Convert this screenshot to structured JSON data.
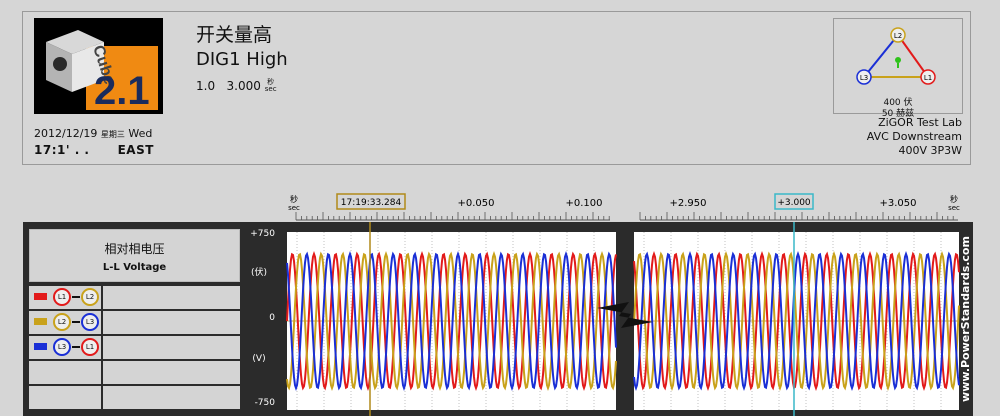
{
  "header": {
    "logo_word": "Cube",
    "logo_version": "2.1",
    "event_title_cn": "开关量高",
    "event_title_en": "DIG1 High",
    "duration_count": "1.0",
    "duration_value": "3.000",
    "duration_unit_cn": "秒",
    "duration_unit_en": "sec",
    "date": "2012/12/19",
    "weekday_cn": "星期三",
    "weekday_en": "Wed",
    "time": "17:1'  .   .",
    "timezone": "EAST"
  },
  "phasor": {
    "labels": [
      "L2",
      "L3",
      "L1"
    ],
    "voltage": "400 伏",
    "frequency": "50 赫兹"
  },
  "site": {
    "lab": "ZiGOR Test Lab",
    "location": "AVC Downstream",
    "config": "400V 3P3W"
  },
  "time_axis": {
    "unit_cn": "秒",
    "unit_en": "sec",
    "trigger_time": "17:19:33.284",
    "left_ticks": [
      "+0.050",
      "+0.100"
    ],
    "right_ticks": [
      "+2.950",
      "+3.050"
    ],
    "cursor_label": "+3.000"
  },
  "legend": {
    "title_cn": "相对相电压",
    "title_en": "L-L Voltage",
    "rows": [
      {
        "a": "L1",
        "b": "L2",
        "color": "#e21a1a"
      },
      {
        "a": "L2",
        "b": "L3",
        "color": "#c9a21b"
      },
      {
        "a": "L3",
        "b": "L1",
        "color": "#1a2fd6"
      }
    ]
  },
  "colors": {
    "l1": "#e21a1a",
    "l2": "#c9a21b",
    "l3": "#1a2fd6",
    "cursor": "#3ab8c8"
  },
  "watermark": "www.PowerStandards.com",
  "chart_data": {
    "type": "line",
    "ylabel_top": "(伏)",
    "ylabel_bottom": "(V)",
    "yticks": [
      "+750",
      "0",
      "-750"
    ],
    "ylim": [
      -750,
      750
    ],
    "series": [
      {
        "name": "L1-L2",
        "color": "#e21a1a",
        "amplitude": 565
      },
      {
        "name": "L2-L3",
        "color": "#c9a21b",
        "amplitude": 565
      },
      {
        "name": "L3-L1",
        "color": "#1a2fd6",
        "amplitude": 565
      }
    ],
    "frequency_hz": 50
  }
}
